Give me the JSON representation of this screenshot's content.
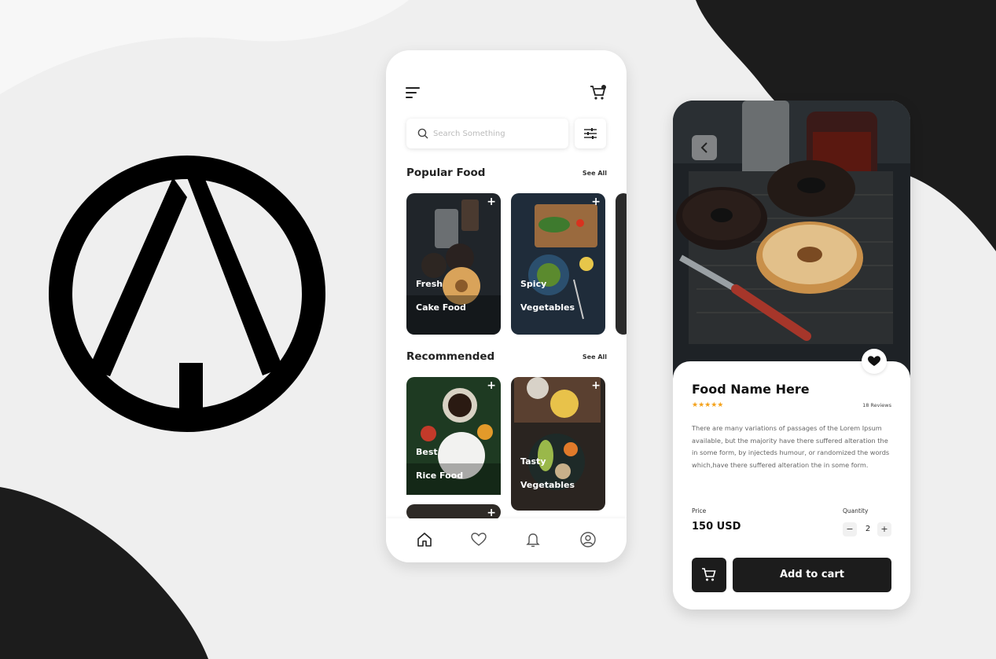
{
  "colors": {
    "background": "#efefef",
    "dark": "#1c1c1c",
    "accent_star": "#f4a21b",
    "white": "#ffffff"
  },
  "phone_home": {
    "menu_icon": "hamburger-menu-icon",
    "cart_icon": "cart-icon",
    "search": {
      "placeholder": "Search Something",
      "icon": "search-icon"
    },
    "filter_icon": "filter-sliders-icon",
    "popular": {
      "title": "Popular Food",
      "see_all": "See All",
      "items": [
        {
          "label_line1": "Fresh",
          "label_line2": "Cake Food"
        },
        {
          "label_line1": "Spicy",
          "label_line2": "Vegetables"
        }
      ]
    },
    "recommended": {
      "title": "Recommended",
      "see_all": "See All",
      "items": [
        {
          "label_line1": "Best",
          "label_line2": "Rice Food"
        },
        {
          "label_line1": "Tasty",
          "label_line2": "Vegetables"
        }
      ]
    },
    "card_add_symbol": "+",
    "nav": [
      "home-icon",
      "heart-icon",
      "bell-icon",
      "profile-icon"
    ]
  },
  "phone_detail": {
    "back_icon": "chevron-left-icon",
    "favorite_icon": "heart-icon",
    "food_name": "Food Name Here",
    "stars": "★★★★★",
    "rating": 4.5,
    "reviews": "18 Reviews",
    "description": "There are many variations of passages of the Lorem Ipsum available, but the majority have there suffered alteration the in some form, by injecteds humour, or randomized the words which,have there suffered alteration the in some form.",
    "price_label": "Price",
    "price": "150 USD",
    "quantity_label": "Quantity",
    "qty_minus": "−",
    "quantity": "2",
    "qty_plus": "+",
    "cart_icon": "cart-icon",
    "add_to_cart": "Add to cart"
  }
}
